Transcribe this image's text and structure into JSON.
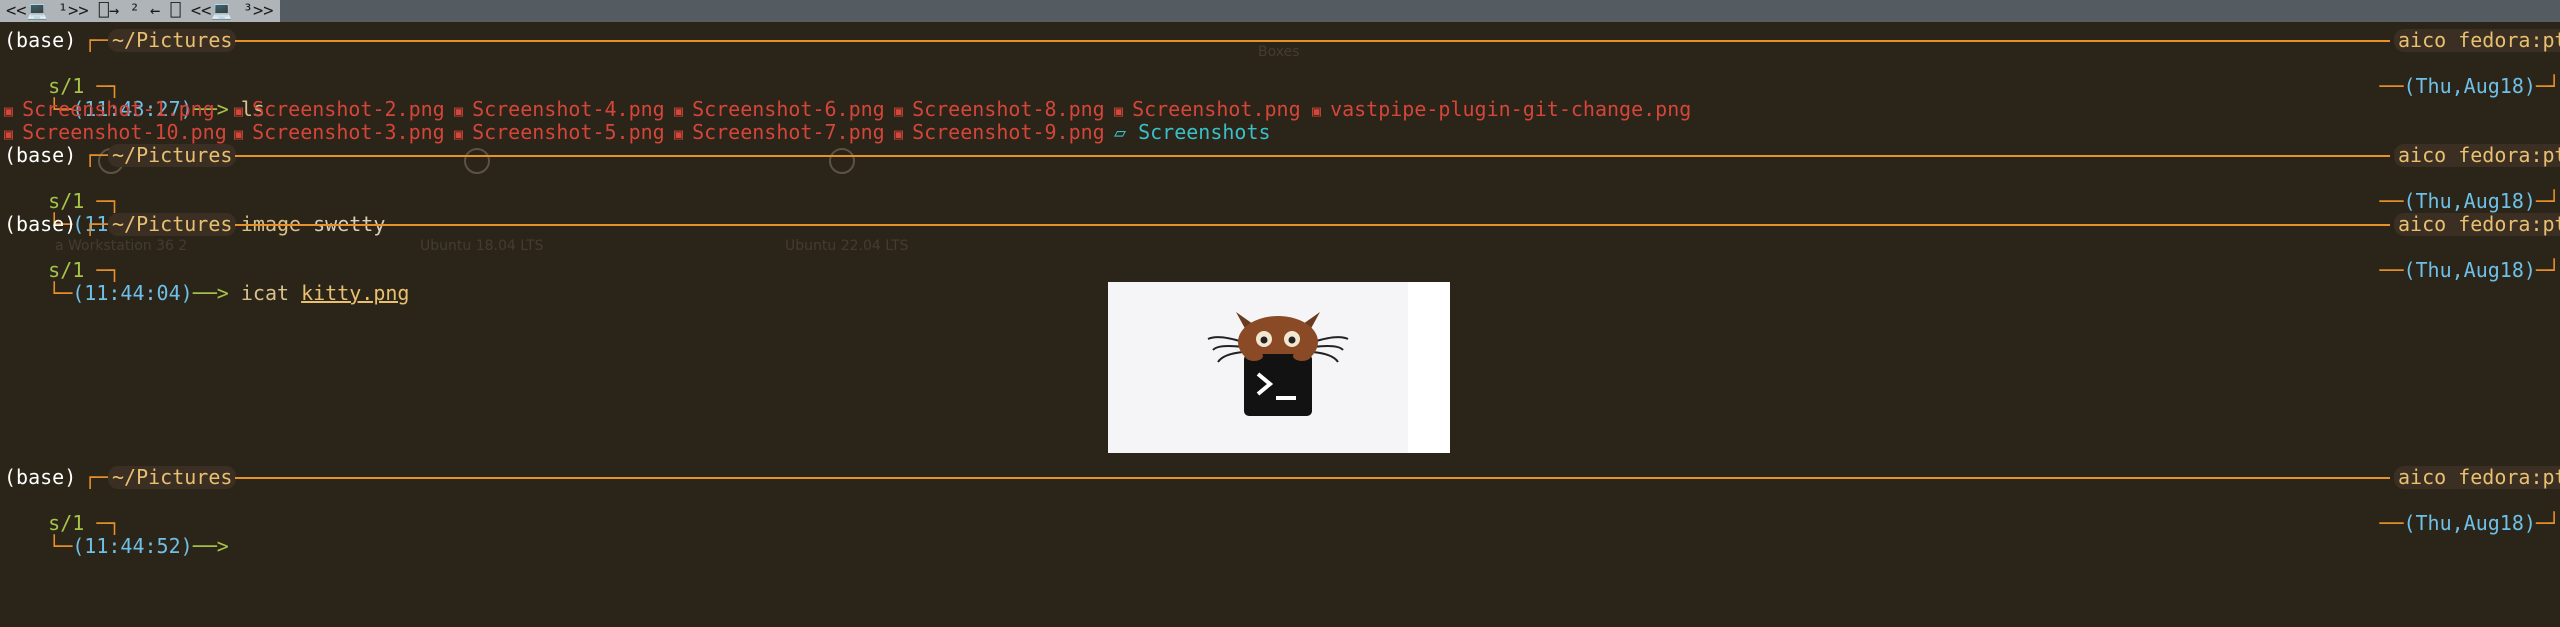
{
  "topbar": {
    "tab_label": "<<💻 ¹>> ⎕→ ² ← ⎕ <<💻 ³>>"
  },
  "ghost_overlay": {
    "window_title": "Boxes",
    "vm1": "a Workstation 36 2",
    "vm2": "Ubuntu 18.04 LTS",
    "vm3": "Ubuntu 22.04 LTS"
  },
  "prompt": {
    "env": "(base)",
    "dir": "~/Pictures",
    "user": "aico",
    "host": "fedora:pt",
    "tty": "s/1",
    "date": "(Thu,Aug18)"
  },
  "blocks": [
    {
      "time": "(11:43:27)",
      "cmd": "ls",
      "args": ""
    },
    {
      "time": "(11:43:28)",
      "cmd": "image",
      "args": "swetty"
    },
    {
      "time": "(11:44:04)",
      "cmd": "icat",
      "args": "kitty.png"
    },
    {
      "time": "(11:44:52)",
      "cmd": "",
      "args": ""
    }
  ],
  "ls_output": {
    "row1": [
      "Screenshot-1.png",
      "Screenshot-2.png",
      "Screenshot-4.png",
      "Screenshot-6.png",
      "Screenshot-8.png",
      "Screenshot.png",
      "vastpipe-plugin-git-change.png"
    ],
    "row2": [
      "Screenshot-10.png",
      "Screenshot-3.png",
      "Screenshot-5.png",
      "Screenshot-7.png",
      "Screenshot-9.png"
    ],
    "folder": "Screenshots"
  },
  "colors": {
    "background": "#2b2418",
    "rule": "#e8902a",
    "time": "#6ec0e8",
    "file": "#d4453a",
    "folder": "#38c0c8"
  }
}
